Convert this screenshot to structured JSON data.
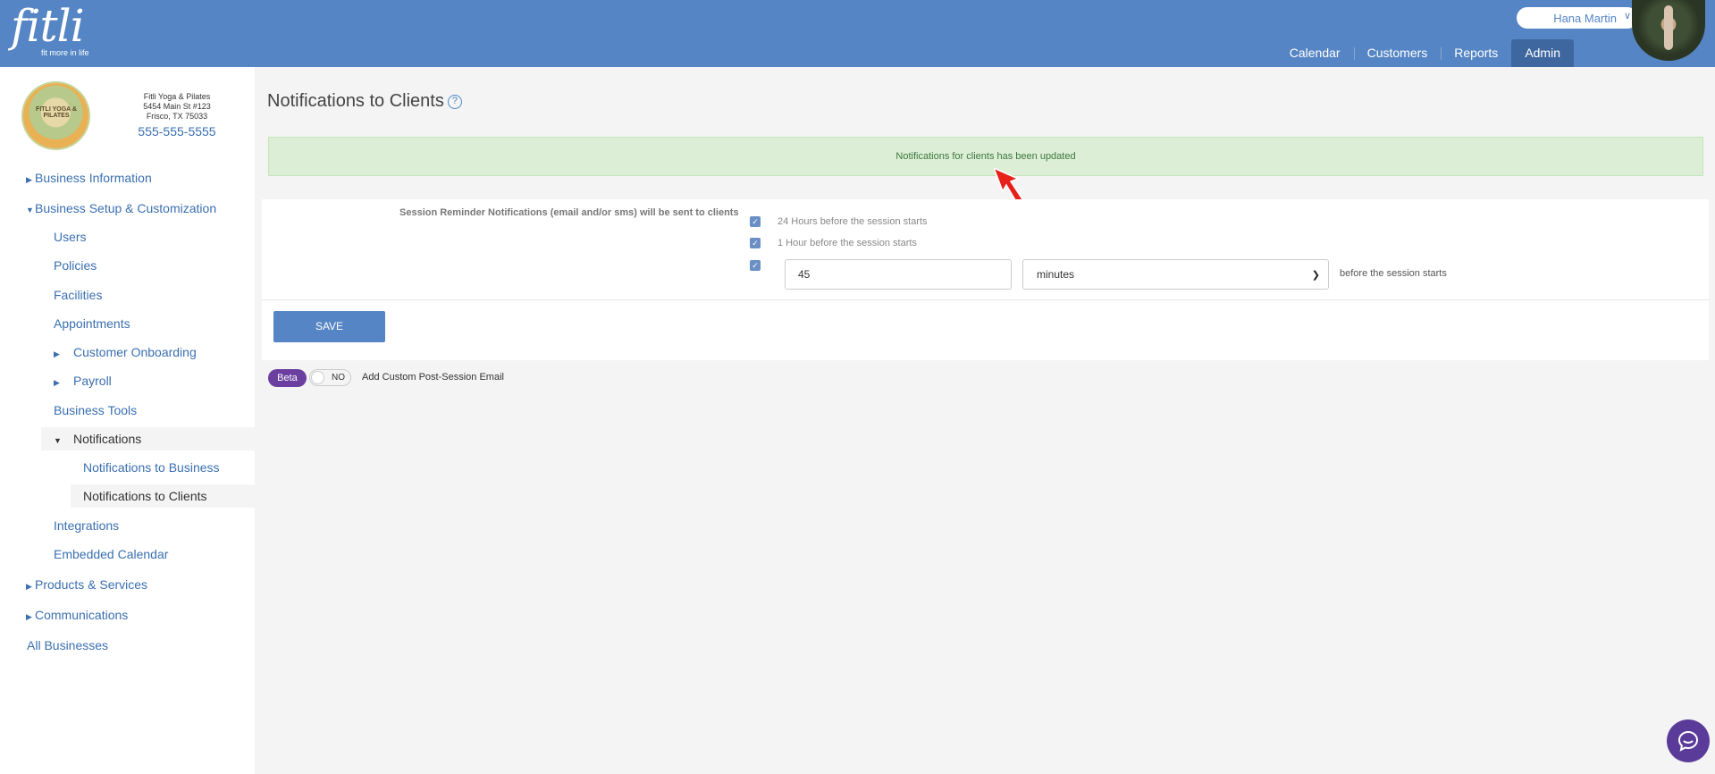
{
  "header": {
    "logo_word": "fitli",
    "logo_tagline": "fit more in life",
    "user_name": "Hana Martin",
    "nav": [
      {
        "label": "Calendar"
      },
      {
        "label": "Customers"
      },
      {
        "label": "Reports"
      },
      {
        "label": "Admin",
        "active": true
      }
    ]
  },
  "business": {
    "logo_text": "FITLI YOGA & PILATES",
    "name": "Fitli Yoga & Pilates",
    "address1": "5454 Main St #123",
    "address2": "Frisco, TX 75033",
    "phone": "555-555-5555"
  },
  "sidebar": {
    "items": [
      {
        "label": "Business Information"
      },
      {
        "label": "Business Setup & Customization"
      },
      {
        "label": "Users"
      },
      {
        "label": "Policies"
      },
      {
        "label": "Facilities"
      },
      {
        "label": "Appointments"
      },
      {
        "label": "Customer Onboarding"
      },
      {
        "label": "Payroll"
      },
      {
        "label": "Business Tools"
      },
      {
        "label": "Notifications"
      },
      {
        "label": "Notifications to Business"
      },
      {
        "label": "Notifications to Clients"
      },
      {
        "label": "Integrations"
      },
      {
        "label": "Embedded Calendar"
      },
      {
        "label": "Products & Services"
      },
      {
        "label": "Communications"
      },
      {
        "label": "All Businesses"
      }
    ]
  },
  "main": {
    "title": "Notifications to Clients",
    "alert": "Notifications for clients has been updated",
    "reminder_label": "Session Reminder Notifications (email and/or sms) will be sent to clients",
    "options": [
      {
        "label": "24 Hours before the session starts",
        "checked": true
      },
      {
        "label": "1 Hour before the session starts",
        "checked": true
      },
      {
        "label": "",
        "checked": true
      }
    ],
    "custom_value": "45",
    "custom_unit": "minutes",
    "custom_suffix": "before the session starts",
    "save_label": "SAVE",
    "beta_label": "Beta",
    "toggle_state": "NO",
    "custom_email_label": "Add Custom Post-Session Email"
  },
  "colors": {
    "header": "#5585c4",
    "nav_active": "#3f679f",
    "alert_bg": "#dcefd6",
    "alert_text": "#3c763d",
    "beta": "#6a3fa0",
    "chat": "#5a3b9a"
  }
}
